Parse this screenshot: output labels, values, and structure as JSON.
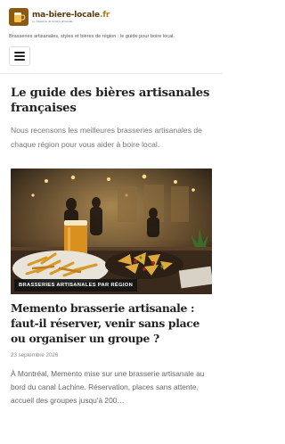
{
  "site": {
    "logo_name_main": "ma-biere-locale",
    "logo_name_tld": ".fr",
    "logo_subtitle": "Le magazine de la bière artisanale",
    "tagline": "Brasseries artisanales, styles et bières de région : le guide pour boire local."
  },
  "intro": {
    "title": "Le guide des bières artisanales françaises",
    "text": "Nous recensons les meilleures brasseries artisanales de chaque région pour vous aider à boire local."
  },
  "article": {
    "category": "BRASSERIES ARTISANALES PAR RÉGION",
    "title": "Memento brasserie artisanale : faut-il réserver, venir sans place ou organiser un groupe ?",
    "date": "23 septembre 2026",
    "excerpt": "À Montréal, Memento mise sur une brasserie artisanale au bord du canal Lachine. Réservation, places sans attente, accueil des groupes jusqu'à 200…"
  },
  "icons": {
    "logo": "beer-glass-logo-icon",
    "menu": "hamburger-menu-icon"
  },
  "colors": {
    "brand_brown": "#5b3a10",
    "brand_gold": "#b07a22",
    "badge_bg": "#141414"
  }
}
